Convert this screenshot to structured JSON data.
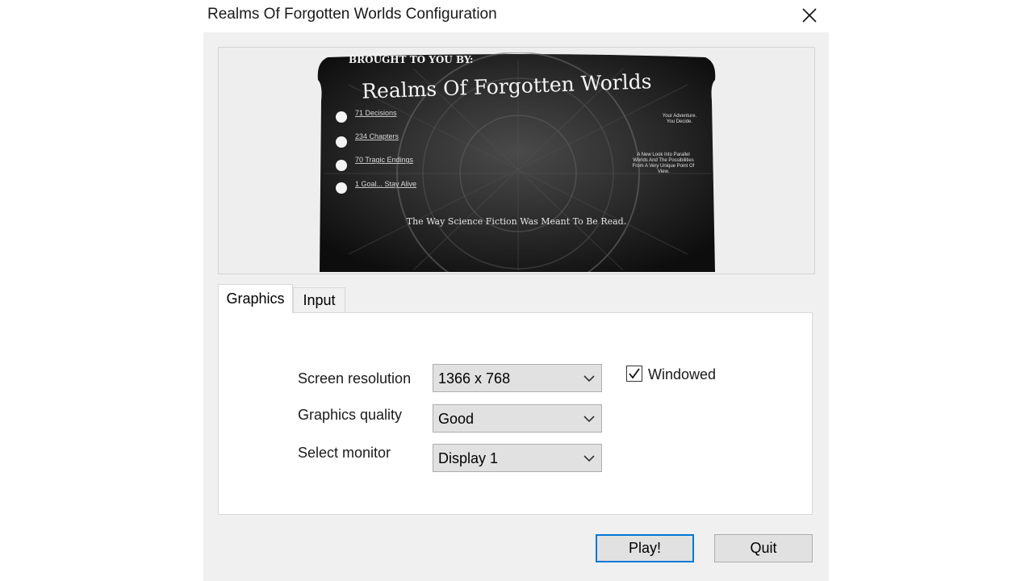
{
  "window": {
    "title": "Realms Of Forgotten Worlds Configuration",
    "close_icon": "close-icon"
  },
  "banner": {
    "header": "BROUGHT TO YOU BY:",
    "title": "Realms Of Forgotten Worlds",
    "bullets": [
      "71 Decisions",
      "234 Chapters",
      "70 Tragic Endings",
      "1 Goal... Stay Alive"
    ],
    "side_note_1": [
      "Your Adventure.",
      "You Decide."
    ],
    "side_note_2": [
      "A New Look Into Parallel",
      "Worlds And The Possibilities",
      "From A Very Unique Point Of",
      "View."
    ],
    "tagline": "The Way Science Fiction Was Meant To Be Read."
  },
  "tabs": [
    {
      "label": "Graphics",
      "active": true
    },
    {
      "label": "Input",
      "active": false
    }
  ],
  "graphics": {
    "resolution_label": "Screen resolution",
    "resolution_value": "1366 x 768",
    "quality_label": "Graphics quality",
    "quality_value": "Good",
    "monitor_label": "Select monitor",
    "monitor_value": "Display 1",
    "windowed_label": "Windowed",
    "windowed_checked": true
  },
  "buttons": {
    "play": "Play!",
    "quit": "Quit"
  },
  "colors": {
    "accent": "#0078d7",
    "window_bg": "#f0f0f0",
    "combo_bg": "#e1e1e1"
  }
}
